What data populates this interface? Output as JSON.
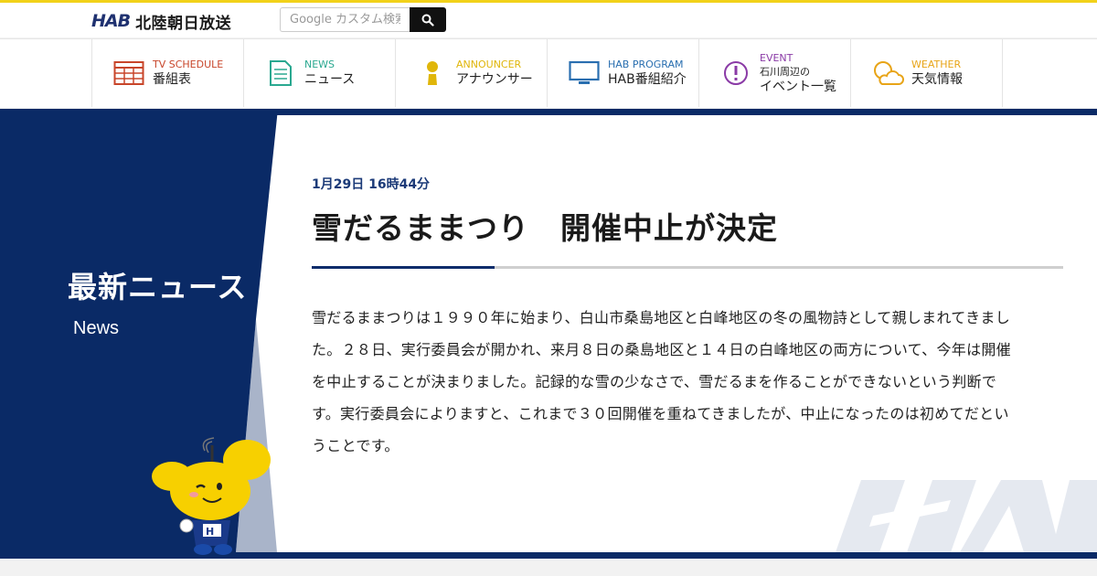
{
  "header": {
    "logo_mark": "HAB",
    "logo_text": "北陸朝日放送",
    "search_placeholder": "Google カスタム検索",
    "search_icon": "search-icon"
  },
  "nav": {
    "items": [
      {
        "en": "TV SCHEDULE",
        "ja": "番組表",
        "icon": "tv-schedule-icon",
        "color": "#c8452a"
      },
      {
        "en": "NEWS",
        "ja": "ニュース",
        "icon": "news-icon",
        "color": "#2aa890"
      },
      {
        "en": "ANNOUNCER",
        "ja": "アナウンサー",
        "icon": "announcer-icon",
        "color": "#e0b60a"
      },
      {
        "en": "HAB PROGRAM",
        "ja": "HAB番組紹介",
        "icon": "monitor-icon",
        "color": "#2a6fb0"
      },
      {
        "en": "EVENT",
        "ja1": "石川周辺の",
        "ja2": "イベント一覧",
        "icon": "event-icon",
        "color": "#8a3aa6"
      },
      {
        "en": "WEATHER",
        "ja": "天気情報",
        "icon": "weather-icon",
        "color": "#e8a417"
      }
    ]
  },
  "sidebar": {
    "title": "最新ニュース",
    "subtitle": "News"
  },
  "article": {
    "date": "1月29日 16時44分",
    "headline": "雪だるままつり　開催中止が決定",
    "body": "雪だるままつりは１９９０年に始まり、白山市桑島地区と白峰地区の冬の風物詩として親しまれてきました。２８日、実行委員会が開かれ、来月８日の桑島地区と１４日の白峰地区の両方について、今年は開催を中止することが決まりました。記録的な雪の少なさで、雪だるまを作ることができないという判断です。実行委員会によりますと、これまで３０回開催を重ねてきましたが、中止になったのは初めてだということです。"
  },
  "watermark": "HAB",
  "colors": {
    "navy": "#0a2a66",
    "accent_yellow": "#f2d21a"
  }
}
